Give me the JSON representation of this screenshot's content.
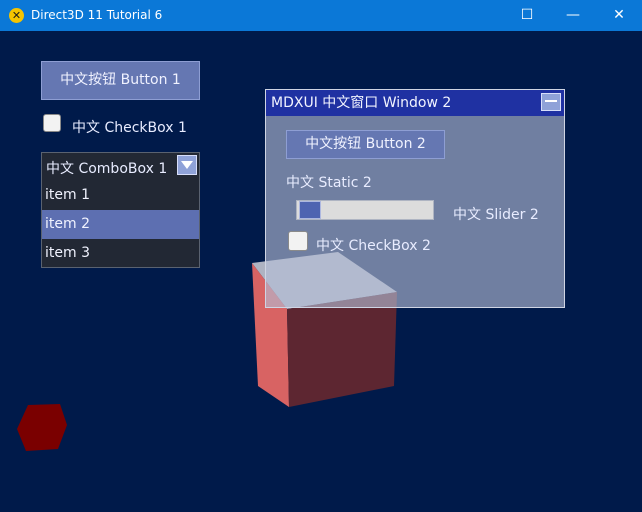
{
  "window": {
    "title": "Direct3D 11 Tutorial 6",
    "icon": "directx-icon",
    "minimize_glyph": "—",
    "maximize_glyph": "☐",
    "close_glyph": "✕"
  },
  "panel1": {
    "button_label": "中文按钮 Button 1",
    "checkbox_label": "中文 CheckBox 1",
    "checkbox_checked": false,
    "combobox": {
      "selected": "中文 ComboBox 1",
      "items": [
        "item 1",
        "item 2",
        "item 3"
      ],
      "highlighted_index": 1
    }
  },
  "window2": {
    "title": "MDXUI 中文窗口 Window 2",
    "button_label": "中文按钮 Button 2",
    "static_label": "中文 Static 2",
    "slider_label": "中文 Slider 2",
    "slider_value": 0.0,
    "checkbox_label": "中文 CheckBox 2",
    "checkbox_checked": false
  },
  "colors": {
    "background": "#001a4a",
    "accent_titlebar": "#0b78d7",
    "button": "#6577b2",
    "window2_title": "#1f31a2",
    "cube_light": "#d55f60",
    "cube_dark": "#5e2630",
    "hexagon": "#7a0000"
  }
}
